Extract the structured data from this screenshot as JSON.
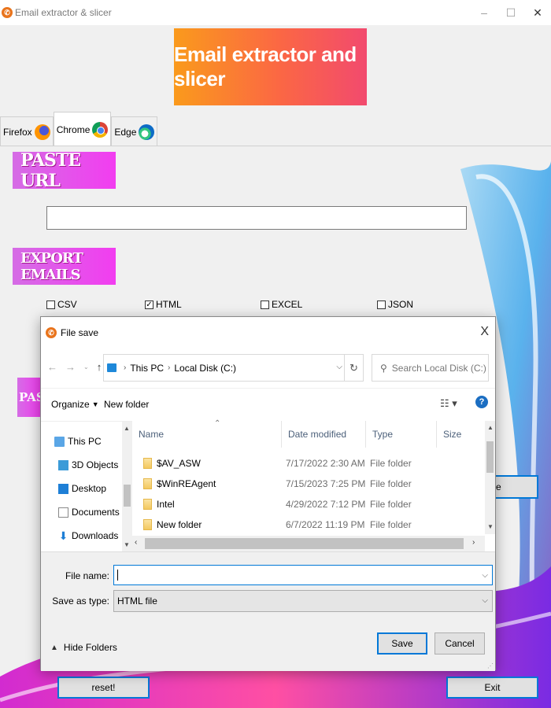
{
  "window": {
    "title": "Email extractor & slicer",
    "controls": [
      "–",
      "☐",
      "✕"
    ]
  },
  "banner": {
    "text": "Email extractor and slicer"
  },
  "tabs": [
    {
      "label": "Firefox",
      "icon": "firefox-icon"
    },
    {
      "label": "Chrome",
      "icon": "chrome-icon",
      "active": true
    },
    {
      "label": "Edge",
      "icon": "edge-icon"
    }
  ],
  "sections": {
    "paste_url": "PASTE URL",
    "export_emails": "EXPORT EMAILS",
    "partial_label": "PAST"
  },
  "url_input": {
    "value": ""
  },
  "export_options": [
    {
      "label": "CSV",
      "checked": false
    },
    {
      "label": "HTML",
      "checked": true
    },
    {
      "label": "EXCEL",
      "checked": false
    },
    {
      "label": "JSON",
      "checked": false
    }
  ],
  "buttons": {
    "partial_right": "e",
    "reset": "reset!",
    "exit": "Exit"
  },
  "dialog": {
    "title": "File save",
    "close": "X",
    "breadcrumb": [
      "This PC",
      "Local Disk (C:)"
    ],
    "search_placeholder": "Search Local Disk (C:)",
    "organize": "Organize",
    "new_folder": "New folder",
    "help": "?",
    "nav_items": [
      {
        "label": "This PC",
        "icon": "computer-icon"
      },
      {
        "label": "3D Objects",
        "icon": "cube-icon"
      },
      {
        "label": "Desktop",
        "icon": "desktop-icon"
      },
      {
        "label": "Documents",
        "icon": "document-icon"
      },
      {
        "label": "Downloads",
        "icon": "download-arrow-icon"
      }
    ],
    "columns": [
      "Name",
      "Date modified",
      "Type",
      "Size"
    ],
    "files": [
      {
        "name": "$AV_ASW",
        "date": "7/17/2022 2:30 AM",
        "type": "File folder"
      },
      {
        "name": "$WinREAgent",
        "date": "7/15/2023 7:25 PM",
        "type": "File folder"
      },
      {
        "name": "Intel",
        "date": "4/29/2022 7:12 PM",
        "type": "File folder"
      },
      {
        "name": "New folder",
        "date": "6/7/2022 11:19 PM",
        "type": "File folder"
      }
    ],
    "file_name_label": "File name:",
    "file_name_value": "",
    "save_type_label": "Save as type:",
    "save_type_value": "HTML file",
    "hide_folders": "Hide Folders",
    "save": "Save",
    "cancel": "Cancel"
  },
  "colors": {
    "banner_start": "#fa9a1c",
    "banner_end": "#f24a6e",
    "section_label": "#e055ea",
    "accent": "#0078d7"
  }
}
